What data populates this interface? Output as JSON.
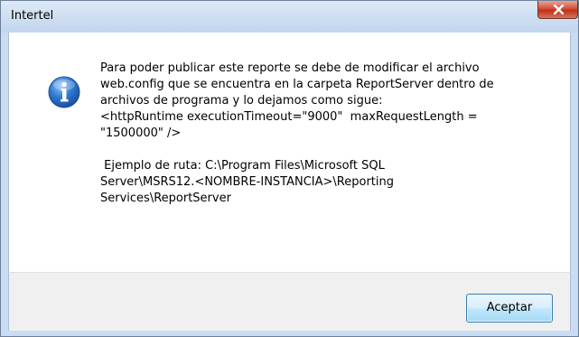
{
  "window": {
    "title": "Intertel"
  },
  "dialog": {
    "icon": "info-icon",
    "message_lines": [
      "Para poder publicar este reporte se debe de modificar el archivo\nweb.config que se encuentra en la carpeta ReportServer dentro de\narchivos de programa y lo dejamos como sigue:\n<httpRuntime executionTimeout=\"9000\"  maxRequestLength =\n\"1500000\" />",
      " Ejemplo de ruta: C:\\Program Files\\Microsoft SQL\nServer\\MSRS12.<NOMBRE-INSTANCIA>\\Reporting\nServices\\ReportServer"
    ]
  },
  "buttons": {
    "accept_label": "Aceptar"
  },
  "colors": {
    "close_button": "#c7442d",
    "info_icon": "#2a6fc7",
    "button_border": "#3c7fb1"
  }
}
